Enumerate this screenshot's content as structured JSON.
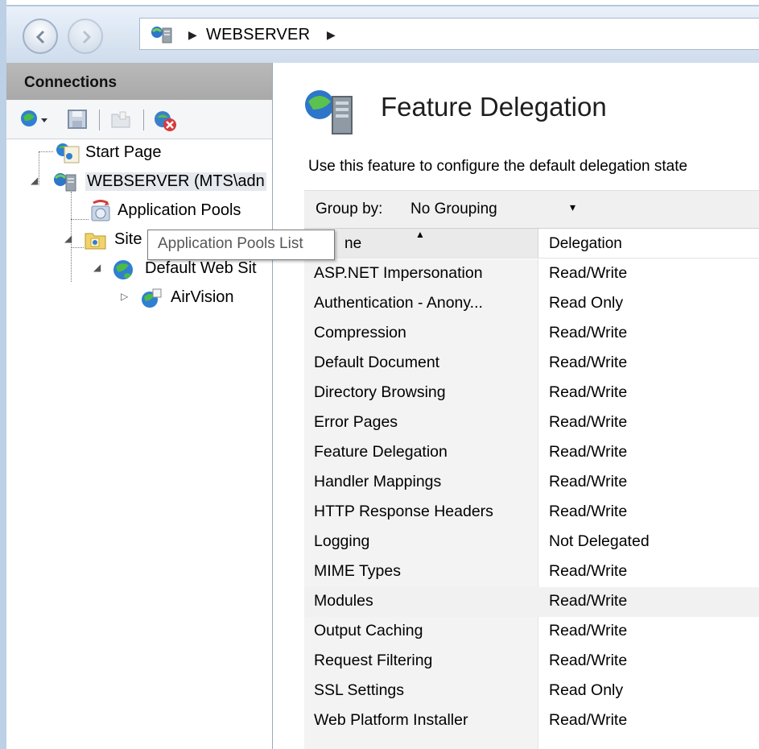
{
  "address": {
    "crumb": "WEBSERVER"
  },
  "connections": {
    "title": "Connections",
    "tree": [
      {
        "label": "Start Page"
      },
      {
        "label": "WEBSERVER (MTS\\adn"
      },
      {
        "label": "Application Pools"
      },
      {
        "label": "Site"
      },
      {
        "label": "Default Web Sit"
      },
      {
        "label": "AirVision"
      }
    ]
  },
  "tooltip": "Application Pools List",
  "main": {
    "title": "Feature Delegation",
    "description": "Use this feature to configure the default delegation state",
    "group_by_label": "Group by:",
    "group_by_value": "No Grouping",
    "col_name": "ne",
    "col_delegation": "Delegation",
    "rows": [
      {
        "name": "ASP.NET Impersonation",
        "delegation": "Read/Write"
      },
      {
        "name": "Authentication - Anony...",
        "delegation": "Read Only"
      },
      {
        "name": "Compression",
        "delegation": "Read/Write"
      },
      {
        "name": "Default Document",
        "delegation": "Read/Write"
      },
      {
        "name": "Directory Browsing",
        "delegation": "Read/Write"
      },
      {
        "name": "Error Pages",
        "delegation": "Read/Write"
      },
      {
        "name": "Feature Delegation",
        "delegation": "Read/Write"
      },
      {
        "name": "Handler Mappings",
        "delegation": "Read/Write"
      },
      {
        "name": "HTTP Response Headers",
        "delegation": "Read/Write"
      },
      {
        "name": "Logging",
        "delegation": "Not Delegated"
      },
      {
        "name": "MIME Types",
        "delegation": "Read/Write"
      },
      {
        "name": "Modules",
        "delegation": "Read/Write"
      },
      {
        "name": "Output Caching",
        "delegation": "Read/Write"
      },
      {
        "name": "Request Filtering",
        "delegation": "Read/Write"
      },
      {
        "name": "SSL Settings",
        "delegation": "Read Only"
      },
      {
        "name": "Web Platform Installer",
        "delegation": "Read/Write"
      }
    ]
  },
  "icons": [
    "back-arrow-icon",
    "forward-arrow-icon",
    "server-icon",
    "globe-icon",
    "save-icon",
    "folder-icon",
    "disconnect-icon",
    "app-pool-icon",
    "sites-folder-icon",
    "web-site-icon",
    "web-app-icon",
    "sort-up-icon",
    "dropdown-arrow-icon"
  ],
  "colors": {
    "highlight_row": "#f1f1f1",
    "header_band": "#b0b0b0",
    "title_bar": "#d6e2f0"
  }
}
